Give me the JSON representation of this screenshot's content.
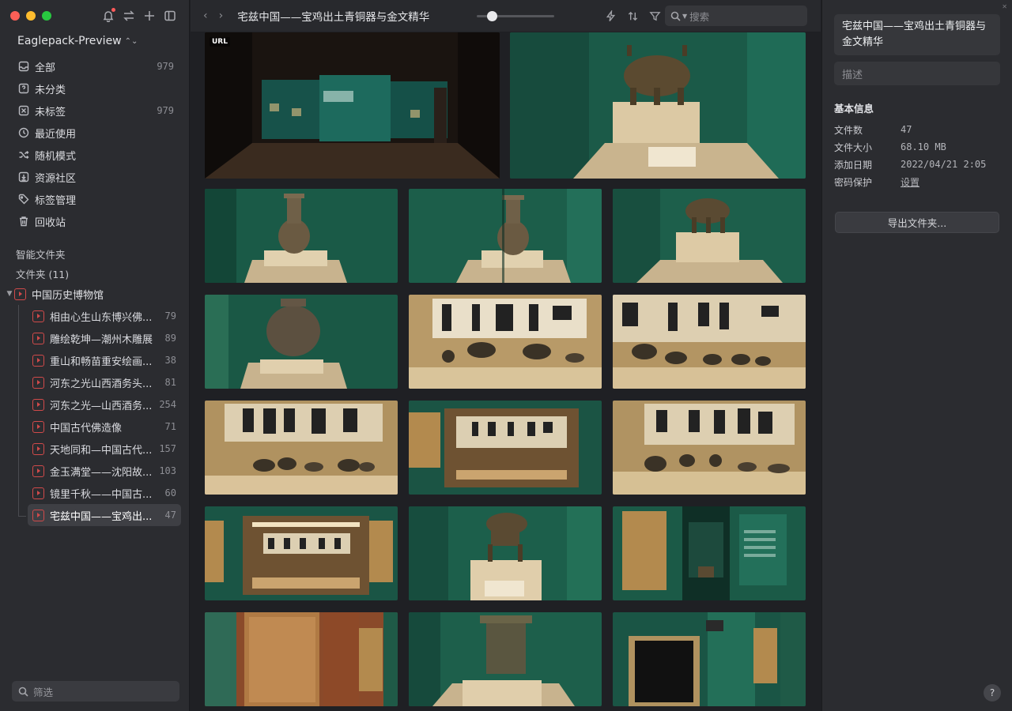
{
  "window": {
    "notification_dot_color": "#ff5a5a"
  },
  "library": {
    "name": "Eaglepack-Preview"
  },
  "nav": [
    {
      "id": "all",
      "label": "全部",
      "count": "979",
      "icon": "tray-icon"
    },
    {
      "id": "uncategorized",
      "label": "未分类",
      "count": "",
      "icon": "question-box-icon"
    },
    {
      "id": "untagged",
      "label": "未标签",
      "count": "979",
      "icon": "tag-off-icon"
    },
    {
      "id": "recent",
      "label": "最近使用",
      "count": "",
      "icon": "clock-icon"
    },
    {
      "id": "random",
      "label": "随机模式",
      "count": "",
      "icon": "shuffle-icon"
    },
    {
      "id": "community",
      "label": "资源社区",
      "count": "",
      "icon": "download-box-icon"
    },
    {
      "id": "tags",
      "label": "标签管理",
      "count": "",
      "icon": "tag-icon"
    },
    {
      "id": "trash",
      "label": "回收站",
      "count": "",
      "icon": "trash-icon"
    }
  ],
  "sections": {
    "smart_folders": "智能文件夹",
    "folders": "文件夹 (11)"
  },
  "tree": {
    "root": {
      "label": "中国历史博物馆"
    },
    "children": [
      {
        "label": "相由心生山东博兴佛...",
        "count": "79"
      },
      {
        "label": "雕绘乾坤—潮州木雕展",
        "count": "89"
      },
      {
        "label": "重山和畅苗重安绘画...",
        "count": "38"
      },
      {
        "label": "河东之光山西酒务头...",
        "count": "81"
      },
      {
        "label": "河东之光—山西酒务...",
        "count": "254"
      },
      {
        "label": "中国古代佛造像",
        "count": "71"
      },
      {
        "label": "天地同和—中国古代...",
        "count": "157"
      },
      {
        "label": "金玉满堂——沈阳故...",
        "count": "103"
      },
      {
        "label": "镜里千秋——中国古...",
        "count": "60"
      },
      {
        "label": "宅兹中国——宝鸡出...",
        "count": "47"
      }
    ]
  },
  "filter": {
    "placeholder": "筛选"
  },
  "toolbar": {
    "back": "‹",
    "forward": "›",
    "title": "宅兹中国——宝鸡出土青铜器与金文精华",
    "zoom": 0.15,
    "search_placeholder": "搜索"
  },
  "grid": {
    "url_badge": "URL"
  },
  "inspector": {
    "title": "宅兹中国——宝鸡出土青铜器与金文精华",
    "description_placeholder": "描述",
    "info_header": "基本信息",
    "rows": [
      {
        "key": "文件数",
        "value": "47"
      },
      {
        "key": "文件大小",
        "value": "68.10 MB"
      },
      {
        "key": "添加日期",
        "value": "2022/04/21 2:05"
      },
      {
        "key": "密码保护",
        "value": "设置"
      }
    ],
    "export_label": "导出文件夹...",
    "help": "?"
  }
}
